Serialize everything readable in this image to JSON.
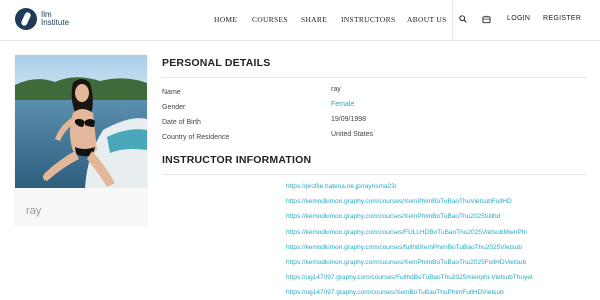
{
  "header": {
    "logo_line1": "Ilm",
    "logo_line2": "Institute",
    "nav": [
      "HOME",
      "COURSES",
      "SHARE",
      "INSTRUCTORS",
      "ABOUT US"
    ],
    "login": "LOGIN",
    "register": "REGISTER",
    "icons": {
      "search": "search-icon",
      "cart": "cart-icon"
    }
  },
  "profile": {
    "name": "ray"
  },
  "personal": {
    "title": "PERSONAL DETAILS",
    "rows": [
      {
        "label": "Name",
        "value": "ray"
      },
      {
        "label": "Gender",
        "value": "Female"
      },
      {
        "label": "Date of Birth",
        "value": "19/09/1998"
      },
      {
        "label": "Country of Residence",
        "value": "United States"
      }
    ]
  },
  "instructor": {
    "title": "INSTRUCTOR INFORMATION",
    "links": [
      "https://profile.hatena.ne.jp/rayrisma23/",
      "https://kemodkimon.graphy.com/courses/XemPhimBoTuBaoThuVietsubFullHD",
      "https://kemodkimon.graphy.com/courses/XemPhimBoTuBaoThu2025fullhd",
      "https://kemodkimon.graphy.com/courses/FULLHDBoTuBaoThu2025VietsubMienPhi",
      "https://kemodkimon.graphy.com/courses/fullhdXemPhimBoTuBaoThu2025Vietsub",
      "https://kemodkimon.graphy.com/courses/XemPhimBoTuBaoThu2025FullHDVietsub",
      "https://ug147097.graphy.com/courses/FullhdBoTuBaoThu2025mienphi-VietsubThuyet",
      "https://ug147097.graphy.com/courses/XemBoTuBaoThuPhimFullHDVietsub"
    ]
  },
  "colors": {
    "brand": "#1f3b57",
    "link": "#27a9c4"
  }
}
